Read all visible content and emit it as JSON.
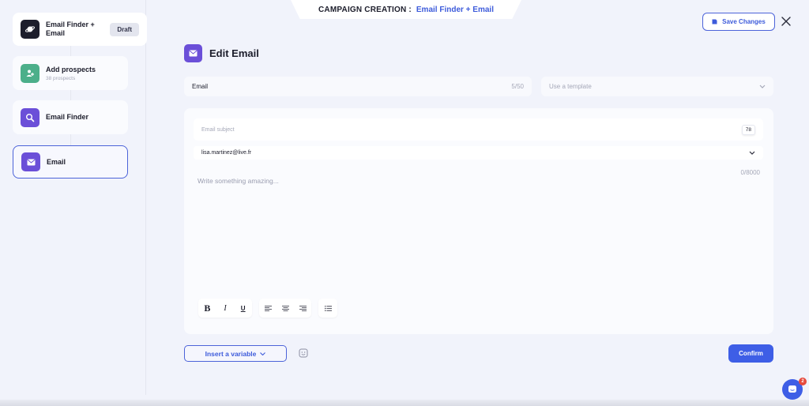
{
  "header": {
    "label": "CAMPAIGN CREATION :",
    "campaign_name": "Email Finder + Email"
  },
  "sidebar": {
    "campaign": {
      "title": "Email Finder + Email",
      "badge": "Draft"
    },
    "steps": [
      {
        "title": "Add prospects",
        "subtitle": "38 prospects",
        "icon": "user-plus-icon",
        "color": "#4caf8a"
      },
      {
        "title": "Email Finder",
        "icon": "search-icon",
        "color": "#6b4fd8"
      },
      {
        "title": "Email",
        "icon": "envelope-icon",
        "color": "#6b4fd8",
        "active": true
      }
    ]
  },
  "actions": {
    "save_label": "Save Changes",
    "confirm_label": "Confirm",
    "insert_variable_label": "Insert a variable"
  },
  "editor": {
    "page_title": "Edit Email",
    "name_value": "Email",
    "name_count": "5/50",
    "template_placeholder": "Use a template",
    "subject_placeholder": "Email subject",
    "subject_counter": "78",
    "sender_value": "lisa.martinez@live.fr",
    "body_count": "0/8000",
    "body_placeholder": "Write something amazing..."
  },
  "chat": {
    "badge": "2"
  },
  "colors": {
    "accent": "#3e5ee6",
    "email_step": "#6b4fd8",
    "prospects_step": "#4caf8a"
  }
}
